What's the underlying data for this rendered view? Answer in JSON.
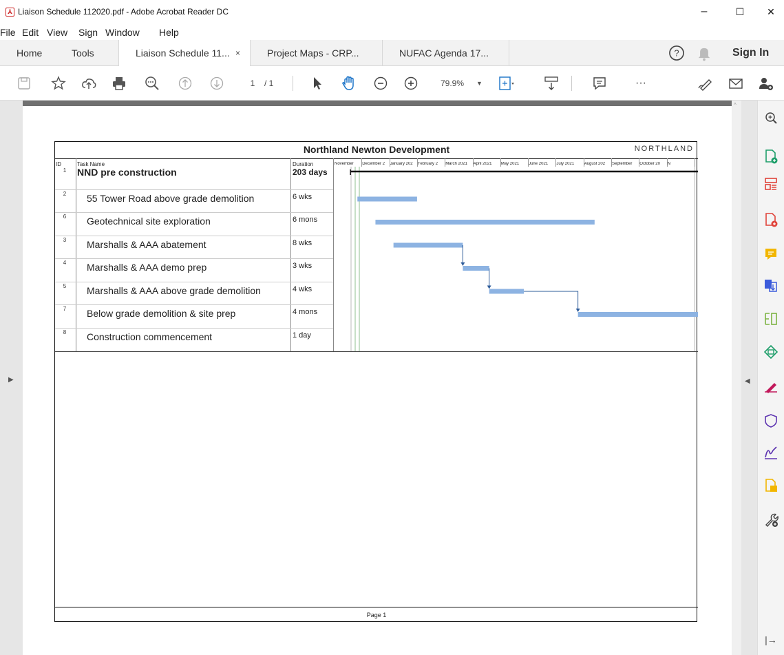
{
  "window": {
    "title": "Liaison Schedule 112020.pdf - Adobe Acrobat Reader DC",
    "minimize": "–",
    "maximize": "☐",
    "close": "✕"
  },
  "menu": [
    "File",
    "Edit",
    "View",
    "Sign",
    "Window",
    "Help"
  ],
  "tabs": {
    "home": "Home",
    "tools": "Tools",
    "docs": [
      {
        "label": "Liaison Schedule 11...",
        "active": true
      },
      {
        "label": "Project Maps - CRP...",
        "active": false
      },
      {
        "label": "NUFAC Agenda 17...",
        "active": false
      }
    ],
    "close_glyph": "×",
    "sign_in": "Sign In"
  },
  "toolbar": {
    "page_current": "1",
    "page_total": "/ 1",
    "zoom": "79.9%",
    "more": "···"
  },
  "document": {
    "title": "Northland Newton Development",
    "logo": "NORTHLAND",
    "headers": {
      "id": "ID",
      "task": "Task Name",
      "duration": "Duration"
    },
    "months": [
      "November",
      "December 2",
      "January 202",
      "February 2",
      "March 2021",
      "April 2021",
      "May 2021",
      "June 2021",
      "July 2021",
      "August 202",
      "September",
      "October 20",
      "N"
    ],
    "tasks": [
      {
        "id": "1",
        "name": "NND pre construction",
        "duration": "203 days",
        "summary": true,
        "start": 0.6,
        "end": 13.8
      },
      {
        "id": "2",
        "name": "55 Tower Road above grade demolition",
        "duration": "6 wks",
        "summary": false,
        "start": 0.85,
        "end": 3.0
      },
      {
        "id": "6",
        "name": "Geotechnical site exploration",
        "duration": "6 mons",
        "summary": false,
        "start": 1.5,
        "end": 9.4
      },
      {
        "id": "3",
        "name": "Marshalls & AAA abatement",
        "duration": "8 wks",
        "summary": false,
        "start": 2.15,
        "end": 4.65
      },
      {
        "id": "4",
        "name": "Marshalls & AAA demo prep",
        "duration": "3 wks",
        "summary": false,
        "start": 4.65,
        "end": 5.6
      },
      {
        "id": "5",
        "name": "Marshalls & AAA above grade demolition",
        "duration": "4 wks",
        "summary": false,
        "start": 5.6,
        "end": 6.85
      },
      {
        "id": "7",
        "name": "Below grade demolition & site prep",
        "duration": "4 mons",
        "summary": false,
        "start": 8.8,
        "end": 13.8
      },
      {
        "id": "8",
        "name": "Construction commencement",
        "duration": "1 day",
        "summary": false,
        "start": 13.8,
        "end": 13.85
      }
    ],
    "footer": "Page 1",
    "bar_color": "#8db3e2",
    "link_color": "#2e5c9a"
  }
}
